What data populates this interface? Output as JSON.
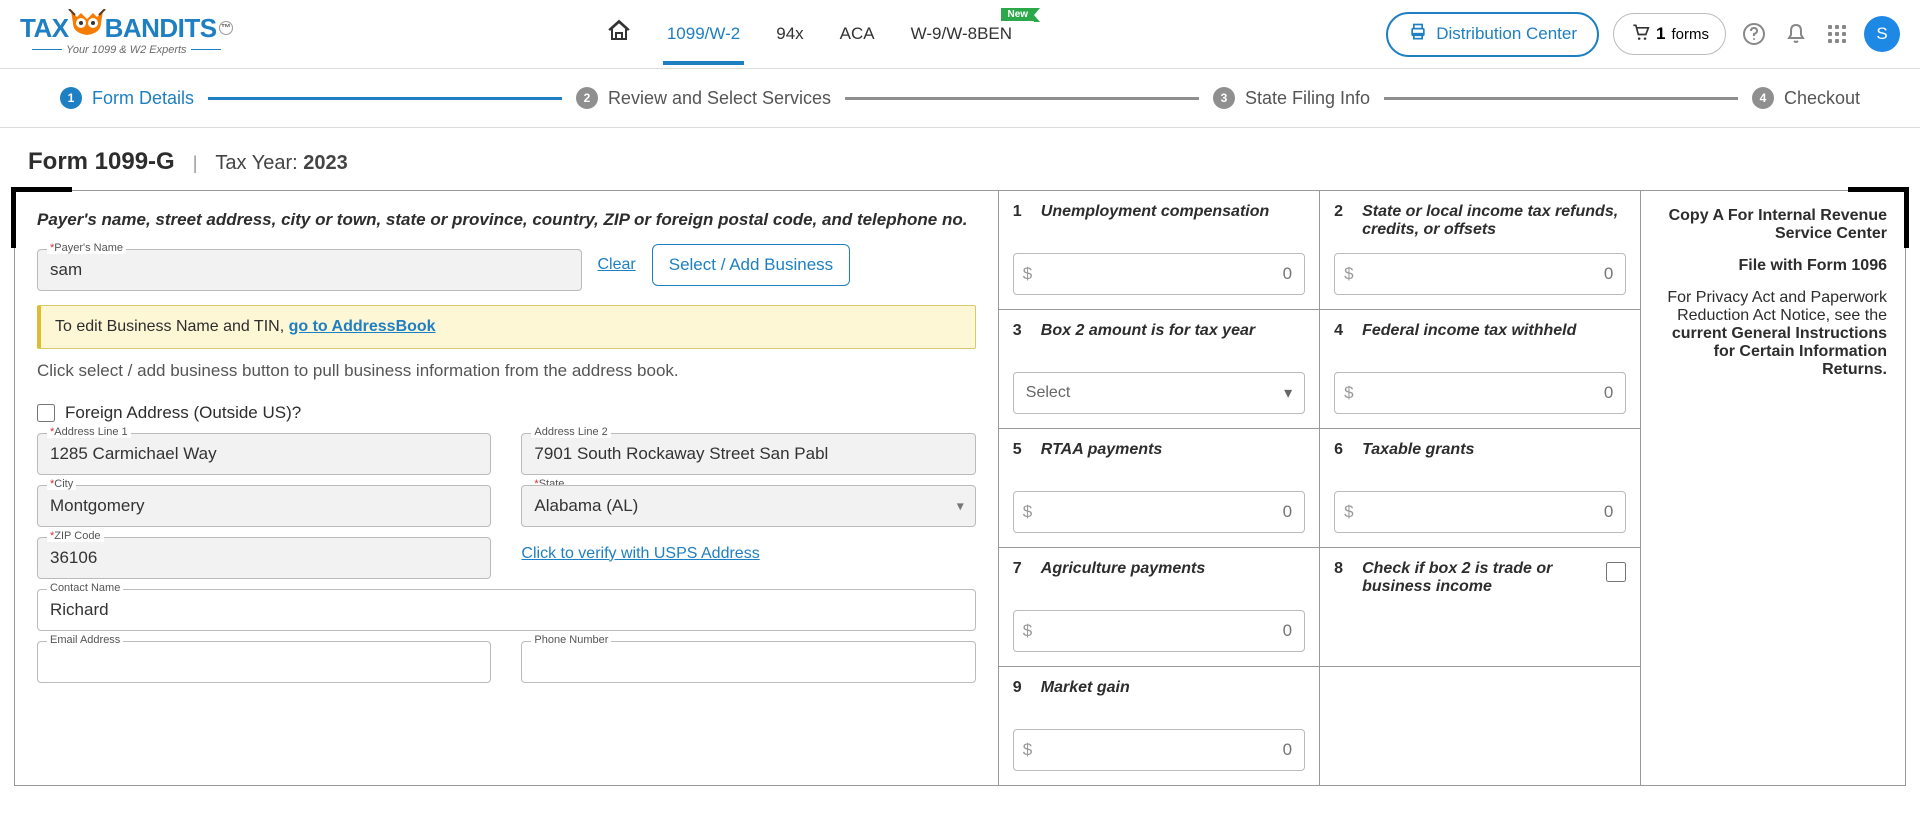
{
  "header": {
    "logo_tax": "TAX",
    "logo_bandits": "BANDITS",
    "logo_tm": "™",
    "tagline": "Your 1099 & W2 Experts",
    "nav": {
      "n1099w2": "1099/W-2",
      "n94x": "94x",
      "aca": "ACA",
      "w9w8": "W-9/W-8BEN",
      "new_badge": "New"
    },
    "dist_center": "Distribution Center",
    "forms_count": "1",
    "forms_label": "forms",
    "avatar": "S"
  },
  "stepper": {
    "s1": "Form Details",
    "s2": "Review and Select Services",
    "s3": "State Filing Info",
    "s4": "Checkout"
  },
  "form": {
    "title": "Form 1099-G",
    "tax_year_label": "Tax Year:",
    "tax_year": "2023",
    "payer_instr": "Payer's name, street address, city or town, state or province, country, ZIP or foreign postal code, and telephone no.",
    "labels": {
      "payer_name": "Payer's Name",
      "addr1": "Address Line 1",
      "addr2": "Address Line 2",
      "city": "City",
      "state": "State",
      "zip": "ZIP Code",
      "contact": "Contact Name",
      "email": "Email Address",
      "phone": "Phone Number"
    },
    "values": {
      "payer_name": "sam",
      "addr1": "1285 Carmichael Way",
      "addr2": "7901 South Rockaway Street San Pabl",
      "city": "Montgomery",
      "state": "Alabama (AL)",
      "zip": "36106",
      "contact": "Richard"
    },
    "clear": "Clear",
    "select_business": "Select / Add Business",
    "note_prefix": "To edit Business Name and TIN, ",
    "note_link": "go to AddressBook",
    "hint": "Click select / add business button to pull business information from the address book.",
    "foreign": "Foreign Address (Outside US)?",
    "verify": "Click to verify with USPS Address"
  },
  "boxes": {
    "b1": "Unemployment compensation",
    "b2": "State or local income tax refunds, credits, or offsets",
    "b3": "Box 2 amount is for tax year",
    "b3_select": "Select",
    "b4": "Federal income tax withheld",
    "b5": "RTAA payments",
    "b6": "Taxable grants",
    "b7": "Agriculture payments",
    "b8": "Check if box 2 is trade or business income",
    "b9": "Market gain",
    "placeholder": "0"
  },
  "copy": {
    "l1": "Copy A For Internal Revenue Service Center",
    "l2": "File with Form 1096",
    "l3a": "For Privacy Act and Paperwork Reduction Act Notice, see the ",
    "l3b": "current General Instructions for Certain Information Returns."
  }
}
